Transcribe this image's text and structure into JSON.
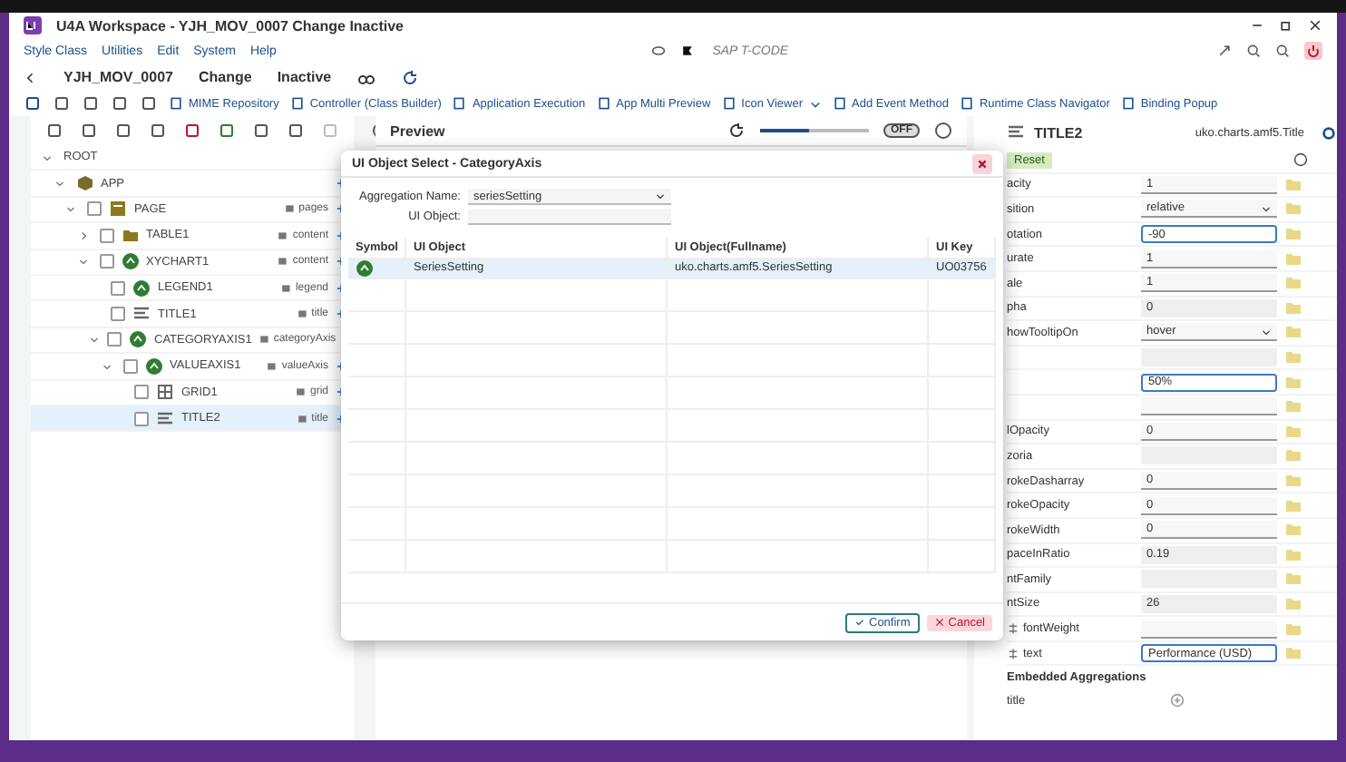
{
  "window": {
    "title": "U4A Workspace - YJH_MOV_0007 Change Inactive"
  },
  "menu": [
    "Style Class",
    "Utilities",
    "Edit",
    "System",
    "Help"
  ],
  "tcode": {
    "placeholder": "SAP T-CODE"
  },
  "header": {
    "app_id": "YJH_MOV_0007",
    "mode": "Change",
    "status": "Inactive"
  },
  "toolbar": [
    {
      "label": "MIME Repository",
      "kind": "button"
    },
    {
      "label": "Controller (Class Builder)",
      "kind": "button"
    },
    {
      "label": "Application Execution",
      "kind": "button"
    },
    {
      "label": "App Multi Preview",
      "kind": "button"
    },
    {
      "label": "Icon Viewer",
      "kind": "dropdown"
    },
    {
      "label": "Add Event Method",
      "kind": "button"
    },
    {
      "label": "Runtime Class Navigator",
      "kind": "button"
    },
    {
      "label": "Binding Popup",
      "kind": "button"
    }
  ],
  "tree": [
    {
      "name": "ROOT",
      "expanded": true,
      "selected": false,
      "children": [
        {
          "name": "APP",
          "kind": "app",
          "expanded": true,
          "selected": false,
          "children": [
            {
              "name": "PAGE",
              "kind": "page",
              "aggregation": "pages",
              "expanded": true,
              "selected": false,
              "children": [
                {
                  "name": "TABLE1",
                  "kind": "table",
                  "aggregation": "content",
                  "expanded": false,
                  "selected": false
                },
                {
                  "name": "XYCHART1",
                  "kind": "chart",
                  "aggregation": "content",
                  "expanded": true,
                  "selected": false,
                  "children": [
                    {
                      "name": "LEGEND1",
                      "kind": "chart",
                      "aggregation": "legend",
                      "selected": false
                    },
                    {
                      "name": "TITLE1",
                      "kind": "title",
                      "aggregation": "title",
                      "selected": false
                    },
                    {
                      "name": "CATEGORYAXIS1",
                      "kind": "chart",
                      "aggregation": "categoryAxis",
                      "expanded": true,
                      "selected": false,
                      "children": [
                        {
                          "name": "VALUEAXIS1",
                          "kind": "chart",
                          "aggregation": "valueAxis",
                          "expanded": true,
                          "selected": false,
                          "children": [
                            {
                              "name": "GRID1",
                              "kind": "grid",
                              "aggregation": "grid",
                              "selected": false
                            },
                            {
                              "name": "TITLE2",
                              "kind": "title",
                              "aggregation": "title",
                              "selected": true
                            }
                          ]
                        }
                      ]
                    }
                  ]
                }
              ]
            }
          ]
        }
      ]
    }
  ],
  "preview": {
    "title": "Preview",
    "zoom": {
      "level": 0.45
    },
    "toggle": {
      "label": "OFF",
      "on": false
    }
  },
  "dialog": {
    "title": "UI Object Select - CategoryAxis",
    "aggregation_label": "Aggregation Name:",
    "aggregation_value": "seriesSetting",
    "object_label": "UI Object:",
    "columns": [
      "Symbol",
      "UI Object",
      "UI Object(Fullname)",
      "UI Key"
    ],
    "rows": [
      {
        "object": "SeriesSetting",
        "fullname": "uko.charts.amf5.SeriesSetting",
        "key": "UO03756",
        "selected": true
      }
    ],
    "buttons": [
      {
        "label": "Confirm",
        "kind": "confirm"
      },
      {
        "label": "Cancel",
        "kind": "cancel"
      }
    ]
  },
  "properties": {
    "title": "TITLE2",
    "class_name": "uko.charts.amf5.Title",
    "reset": "Reset",
    "rows": [
      {
        "label": "acity",
        "kind": "input",
        "value": "1",
        "focused": false,
        "bound": false
      },
      {
        "label": "sition",
        "kind": "select",
        "value": "relative",
        "focused": false,
        "bound": false
      },
      {
        "label": "otation",
        "kind": "input",
        "value": "-90",
        "focused": true,
        "bound": false
      },
      {
        "label": "urate",
        "kind": "input",
        "value": "1",
        "focused": false,
        "bound": false
      },
      {
        "label": "ale",
        "kind": "input",
        "value": "1",
        "focused": false,
        "bound": false
      },
      {
        "label": "pha",
        "kind": "readonly",
        "value": "0",
        "focused": false,
        "bound": false
      },
      {
        "label": "howTooltipOn",
        "kind": "select",
        "value": "hover",
        "focused": false,
        "bound": false
      },
      {
        "kind": "readonly",
        "focused": false,
        "bound": false
      },
      {
        "kind": "input",
        "value": "50%",
        "focused": true,
        "bound": false
      },
      {
        "kind": "input",
        "focused": false,
        "bound": false
      },
      {
        "label": "lOpacity",
        "kind": "input",
        "value": "0",
        "focused": false,
        "bound": false
      },
      {
        "label": "zoria",
        "kind": "readonly",
        "focused": false,
        "bound": false
      },
      {
        "label": "rokeDasharray",
        "kind": "input",
        "value": "0",
        "focused": false,
        "bound": false
      },
      {
        "label": "rokeOpacity",
        "kind": "input",
        "value": "0",
        "focused": false,
        "bound": false
      },
      {
        "label": "rokeWidth",
        "kind": "input",
        "value": "0",
        "focused": false,
        "bound": false
      },
      {
        "label": "paceInRatio",
        "kind": "readonly",
        "value": "0.19",
        "focused": false,
        "bound": false
      },
      {
        "label": "ntFamily",
        "kind": "readonly",
        "focused": false,
        "bound": false
      },
      {
        "label": "ntSize",
        "kind": "readonly",
        "value": "26",
        "focused": false,
        "bound": false
      },
      {
        "label": "fontWeight",
        "kind": "input",
        "focused": false,
        "bound": true
      },
      {
        "label": "text",
        "kind": "input",
        "value": "Performance (USD)",
        "focused": true,
        "bound": true
      }
    ],
    "section": "Embedded Aggregations",
    "aggregations": [
      {
        "name": "title"
      }
    ]
  }
}
